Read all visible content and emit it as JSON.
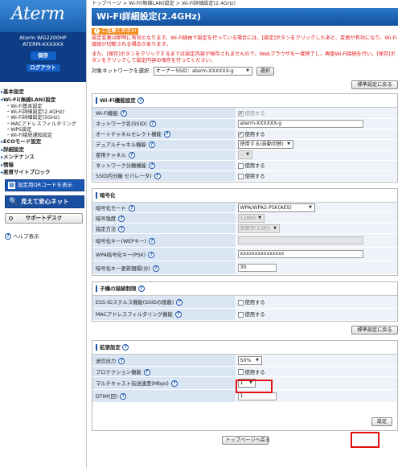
{
  "sidebar": {
    "logo": "Aterm",
    "model": "Aterm WG2200HP",
    "device_id": "ATERM-XXXXXX",
    "save_label": "保存",
    "logout_label": "ログアウト",
    "nav": [
      {
        "label": "基本設定",
        "children": []
      },
      {
        "label": "Wi-Fi(無線LAN)設定",
        "children": [
          "Wi-Fi基本設定",
          "Wi-Fi詳細設定(2.4GHz)",
          "Wi-Fi詳細設定(5GHz)",
          "MACアドレスフィルタリング",
          "WPS設定",
          "Wi-Fi接続通知設定"
        ]
      },
      {
        "label": "ECOモード設定",
        "children": []
      },
      {
        "label": "詳細設定",
        "children": []
      },
      {
        "label": "メンテナンス",
        "children": []
      },
      {
        "label": "情報",
        "children": []
      },
      {
        "label": "悪質サイトブロック",
        "children": []
      }
    ],
    "qr_label": "設定用QRコードを表示",
    "view_label": "見えて安心ネット",
    "support_label": "サポートデスク",
    "help_label": "ヘルプ表示"
  },
  "breadcrumb": "トップページ > Wi-Fi(無線LAN)設定 > Wi-Fi詳細設定(2.4GHz)",
  "title": "Wi-Fi詳細設定(2.4GHz)",
  "notice": {
    "head": "ご注意ください",
    "p1": "設定変更は即時に有効となります。Wi-Fi経由で設定を行っている場合には、[設定]ボタンをクリックしたあと、変更が有効になり、Wi-Fi接続が切断される場合があります。",
    "p2": "また、[保存]ボタンをクリックするまでは設定内容が保存されませんので、Webブラウザを一度終了し、再度Wi-Fi接続を行い、[保存]ボタンをクリックして設定内容の保存を行ってください。"
  },
  "network_select": {
    "label": "対象ネットワークを選択",
    "value": "オーナーSSID：aterm-XXXXXX-g",
    "button": "選択"
  },
  "defaults_button": "標準設定に戻る",
  "sections": {
    "wifi": {
      "title": "Wi-Fi機能設定",
      "rows": {
        "wifi_func": "Wi-Fi機能",
        "ssid": "ネットワーク名(SSID)",
        "auto_channel": "オートチャネルセレクト機能",
        "dual_channel": "デュアルチャネル機能",
        "channel": "使用チャネル",
        "separator": "ネットワーク分離機能",
        "ssid_separator": "SSID内分離 セパレータ)"
      },
      "values": {
        "use": "使用する",
        "ssid": "aterm-XXXXXX-g",
        "dual": "使用する(自動切替)",
        "channel": "―"
      }
    },
    "enc": {
      "title": "暗号化",
      "rows": {
        "mode": "暗号化モード",
        "strength": "暗号強度",
        "method": "指定方法",
        "wep_key": "暗号化キー(WEPキー)",
        "psk": "WPA暗号化キー(PSK)",
        "interval": "暗号化キー更新間隔(分)"
      },
      "values": {
        "mode": "WPA/WPA2-PSK(AES)",
        "strength": "128bit",
        "method": "英数字(13桁)",
        "wep_key": "",
        "psk": "xxxxxxxxxxxxxxx",
        "interval": "30"
      }
    },
    "child": {
      "title": "子機の接続制限",
      "rows": {
        "stealth": "ESS-IDステルス機能(SSIDの隠蔽)",
        "mac": "MACアドレスフィルタリング機能"
      },
      "use": "使用する"
    },
    "ext": {
      "title": "拡張設定",
      "rows": {
        "power": "送信出力",
        "protection": "プロテクション機能",
        "multicast": "マルチキャスト伝送速度(Mbps)",
        "dtim": "DTIM(回)"
      },
      "values": {
        "power": "50%",
        "protection": "使用する",
        "multicast": "1",
        "dtim": "1"
      }
    }
  },
  "set_button": "設定",
  "back_button": "トップページへ戻る"
}
